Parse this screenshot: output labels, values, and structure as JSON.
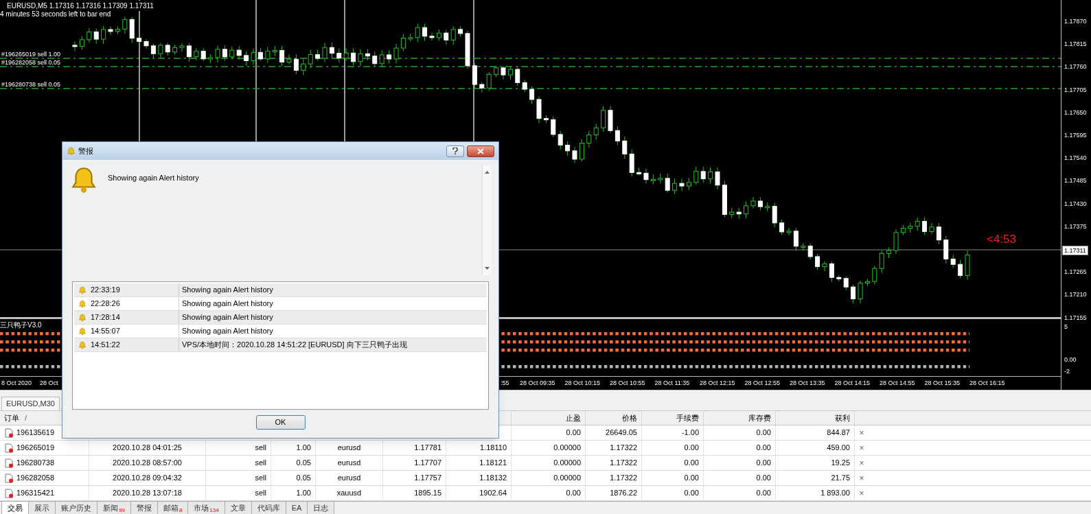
{
  "chart": {
    "symbol_line": "EURUSD,M5  1.17316 1.17316 1.17309 1.17311",
    "timer_line": "4 minutes 53 seconds left to bar end",
    "order_lines": [
      {
        "label": "#196265019 sell 1.00"
      },
      {
        "label": "#196282058 sell 0.05"
      },
      {
        "label": "#196280738 sell 0.05"
      }
    ],
    "countdown": "<4:53",
    "price_axis": [
      "1.17870",
      "1.17815",
      "1.17760",
      "1.17705",
      "1.17650",
      "1.17595",
      "1.17540",
      "1.17485",
      "1.17430",
      "1.17375",
      "1.17265",
      "1.17210",
      "1.17155"
    ],
    "current_price": "1.17311"
  },
  "indicator": {
    "title": "三只鸭子V3.0",
    "axis": [
      "5",
      "0.00",
      "-2"
    ]
  },
  "time_axis": [
    "8 Oct 2020",
    "28 Oct",
    ":55",
    "28 Oct 09:35",
    "28 Oct 10:15",
    "28 Oct 10:55",
    "28 Oct 11:35",
    "28 Oct 12:15",
    "28 Oct 12:55",
    "28 Oct 13:35",
    "28 Oct 14:15",
    "28 Oct 14:55",
    "28 Oct 15:35",
    "28 Oct 16:15"
  ],
  "terminal": {
    "chart_tab": "EURUSD,M30",
    "sort_mark": "/",
    "columns": [
      "订单",
      null,
      null,
      null,
      null,
      null,
      null,
      "止盈",
      "价格",
      "手续费",
      "库存费",
      "获利"
    ],
    "rows": [
      {
        "cells": [
          "196135619",
          null,
          null,
          null,
          null,
          null,
          null,
          "0.00",
          "26649.05",
          "-1.00",
          "0.00",
          "844.87"
        ],
        "close": "×"
      },
      {
        "cells": [
          "196265019",
          "2020.10.28 04:01:25",
          "sell",
          "1.00",
          "eurusd",
          "1.17781",
          "1.18110",
          "0.00000",
          "1.17322",
          "0.00",
          "0.00",
          "459.00"
        ],
        "close": "×"
      },
      {
        "cells": [
          "196280738",
          "2020.10.28 08:57:00",
          "sell",
          "0.05",
          "eurusd",
          "1.17707",
          "1.18121",
          "0.00000",
          "1.17322",
          "0.00",
          "0.00",
          "19.25"
        ],
        "close": "×"
      },
      {
        "cells": [
          "196282058",
          "2020.10.28 09:04:32",
          "sell",
          "0.05",
          "eurusd",
          "1.17757",
          "1.18132",
          "0.00000",
          "1.17322",
          "0.00",
          "0.00",
          "21.75"
        ],
        "close": "×"
      },
      {
        "cells": [
          "196315421",
          "2020.10.28 13:07:18",
          "sell",
          "1.00",
          "xauusd",
          "1895.15",
          "1902.64",
          "0.00",
          "1876.22",
          "0.00",
          "0.00",
          "1 893.00"
        ],
        "close": "×"
      }
    ],
    "tabs": [
      {
        "label": "交易",
        "selected": true
      },
      {
        "label": "展示",
        "selected": false
      },
      {
        "label": "账户历史",
        "selected": false
      },
      {
        "label": "新闻",
        "selected": false,
        "badge": "99"
      },
      {
        "label": "警报",
        "selected": false
      },
      {
        "label": "邮箱",
        "selected": false,
        "badge": "8"
      },
      {
        "label": "市场",
        "selected": false,
        "badge": "134"
      },
      {
        "label": "文章",
        "selected": false
      },
      {
        "label": "代码库",
        "selected": false
      },
      {
        "label": "EA",
        "selected": false
      },
      {
        "label": "日志",
        "selected": false
      }
    ]
  },
  "dialog": {
    "title": "警报",
    "message": "Showing again Alert history",
    "alerts": [
      {
        "time": "22:33:19",
        "text": "Showing again Alert history"
      },
      {
        "time": "22:28:26",
        "text": "Showing again Alert history"
      },
      {
        "time": "17:28:14",
        "text": "Showing again Alert history"
      },
      {
        "time": "14:55:07",
        "text": "Showing again Alert history"
      },
      {
        "time": "14:51:22",
        "text": "VPS/本地时间：2020.10.28 14:51:22 [EURUSD] 向下三只鸭子出现"
      }
    ],
    "ok": "OK"
  }
}
